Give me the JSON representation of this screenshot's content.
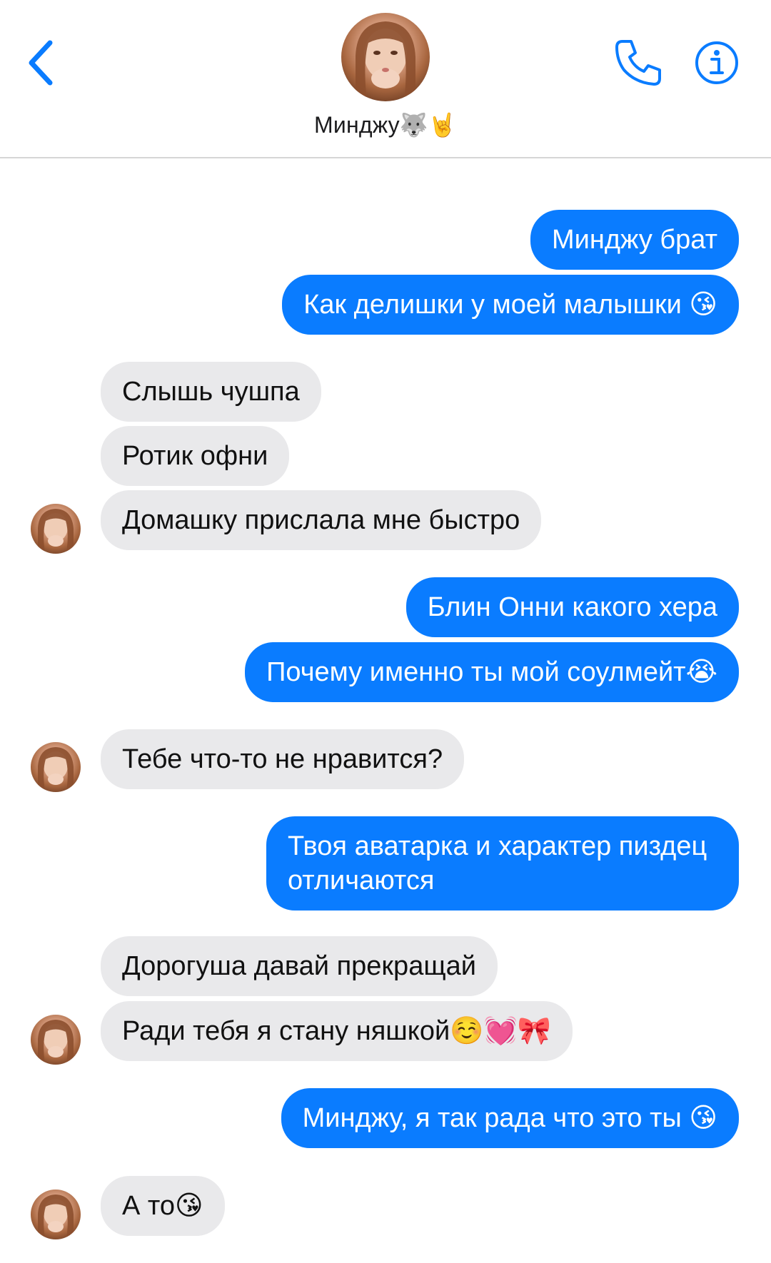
{
  "header": {
    "contact_name": "Минджу🐺🤘"
  },
  "messages": [
    {
      "side": "out",
      "text": "Минджу брат"
    },
    {
      "side": "out",
      "text": "Как делишки у моей малышки 😘"
    },
    {
      "side": "in",
      "text": "Слышь чушпа"
    },
    {
      "side": "in",
      "text": "Ротик офни"
    },
    {
      "side": "in",
      "text": "Домашку прислала мне быстро"
    },
    {
      "side": "out",
      "text": "Блин Онни какого хера"
    },
    {
      "side": "out",
      "text": "Почему именно ты мой соулмейт😭"
    },
    {
      "side": "in",
      "text": "Тебе что-то не нравится?"
    },
    {
      "side": "out",
      "text": "Твоя аватарка и характер пиздец отличаются"
    },
    {
      "side": "in",
      "text": "Дорогуша давай прекращай"
    },
    {
      "side": "in",
      "text": "Ради тебя я стану няшкой☺️💓🎀"
    },
    {
      "side": "out",
      "text": "Минджу, я так рада что это ты 😘"
    },
    {
      "side": "in",
      "text": "А то😘"
    }
  ],
  "colors": {
    "accent": "#0a7cff",
    "incoming_bubble": "#e9e9eb",
    "outgoing_text": "#ffffff",
    "incoming_text": "#111111"
  },
  "icons": {
    "back": "chevron-left-icon",
    "call": "phone-icon",
    "info": "info-icon"
  }
}
